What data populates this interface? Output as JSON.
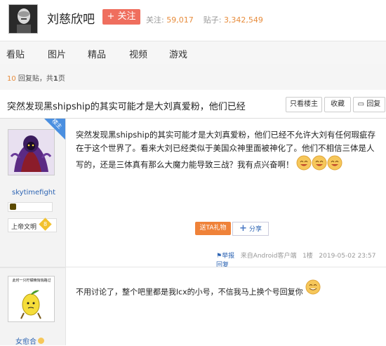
{
  "header": {
    "forum_name": "刘慈欣吧",
    "follow_label": "+ 关注",
    "follow_text": "关注",
    "follow_count_label": "关注:",
    "follow_count": "59,017",
    "post_count_label": "贴子:",
    "post_count": "3,342,549"
  },
  "nav": {
    "items": [
      "看贴",
      "图片",
      "精品",
      "视频",
      "游戏"
    ]
  },
  "pageinfo": {
    "reply_count": "10",
    "reply_label": "回复贴，共",
    "pages": "1",
    "pages_label": "页"
  },
  "thread": {
    "title": "突然发现黑shipship的其实可能才是大刘真爱粉，他们已经",
    "buttons": {
      "op_only": "只看楼主",
      "favorite": "收藏",
      "reply": "回复"
    }
  },
  "posts": [
    {
      "badge": "楼主",
      "username": "skytimefight",
      "level_name": "上帝文明",
      "level": "8",
      "content": "突然发现黑shipship的其实可能才是大刘真爱粉，他们已经不允许大刘有任何瑕疵存在于这个世界了。看来大刘已经类似于美国众神里面被神化了。他们不相信三体是人写的，还是三体真有那么大魔力能导致三战？我有点兴奋啊！",
      "gift_label": "送TA礼物",
      "share_label": "分享",
      "report_label": "举报",
      "source_label": "来自Android客户端",
      "floor": "1楼",
      "timestamp": "2019-05-02 23:57",
      "reply_label": "回复"
    },
    {
      "username": "女愈合",
      "avatar_caption": "此时一只柠檬精悄悄路过",
      "content": "不用讨论了，整个吧里都是我lcx的小号，不信我马上换个号回复你"
    }
  ],
  "colors": {
    "follow_button": "#ef6e5e",
    "accent_orange": "#e78c3c",
    "gift_button": "#ef8239",
    "link_blue": "#2d64b3",
    "badge_blue": "#4a8fe0"
  }
}
